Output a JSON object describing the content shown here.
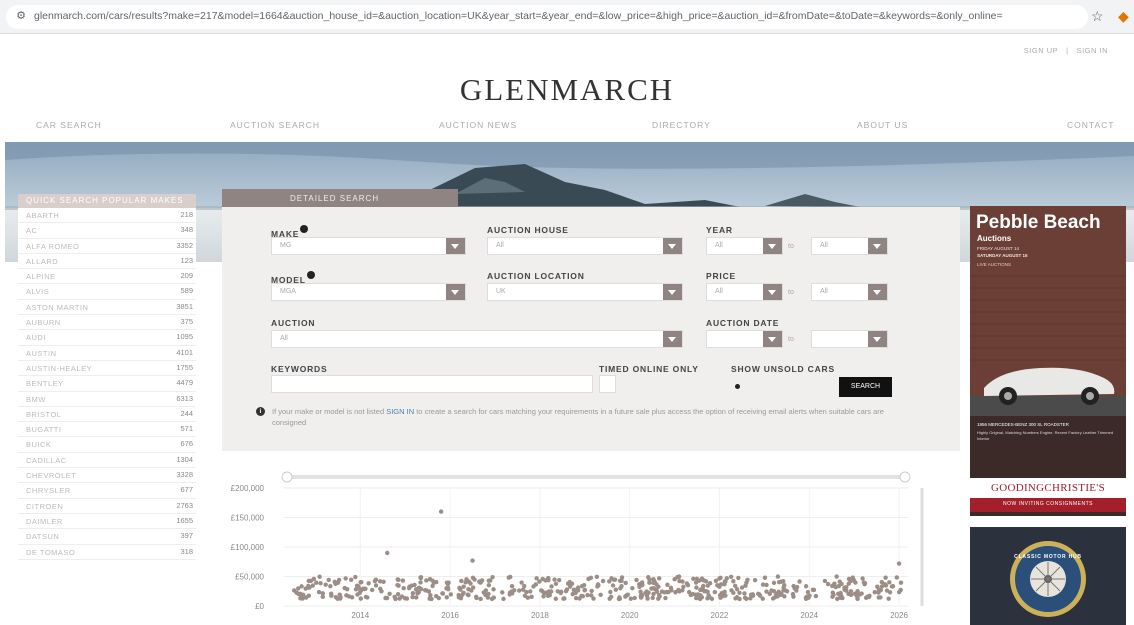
{
  "browser": {
    "url": "glenmarch.com/cars/results?make=217&model=1664&auction_house_id=&auction_location=UK&year_start=&year_end=&low_price=&high_price=&auction_id=&fromDate=&toDate=&keywords=&only_online=",
    "icon": "tune-icon"
  },
  "toplinks": {
    "signup": "SIGN UP",
    "separator": "|",
    "signin": "SIGN IN"
  },
  "logo": "GLENMARCH",
  "nav": {
    "items": [
      "CAR SEARCH",
      "AUCTION SEARCH",
      "AUCTION NEWS",
      "DIRECTORY",
      "ABOUT US",
      "CONTACT"
    ]
  },
  "sidebar": {
    "title": "QUICK SEARCH POPULAR MAKES",
    "makes": [
      {
        "name": "ABARTH",
        "count": "218"
      },
      {
        "name": "AC",
        "count": "348"
      },
      {
        "name": "ALFA ROMEO",
        "count": "3352"
      },
      {
        "name": "ALLARD",
        "count": "123"
      },
      {
        "name": "ALPINE",
        "count": "209"
      },
      {
        "name": "ALVIS",
        "count": "589"
      },
      {
        "name": "ASTON MARTIN",
        "count": "3851"
      },
      {
        "name": "AUBURN",
        "count": "375"
      },
      {
        "name": "AUDI",
        "count": "1095"
      },
      {
        "name": "AUSTIN",
        "count": "4101"
      },
      {
        "name": "AUSTIN-HEALEY",
        "count": "1755"
      },
      {
        "name": "BENTLEY",
        "count": "4479"
      },
      {
        "name": "BMW",
        "count": "6313"
      },
      {
        "name": "BRISTOL",
        "count": "244"
      },
      {
        "name": "BUGATTI",
        "count": "571"
      },
      {
        "name": "BUICK",
        "count": "676"
      },
      {
        "name": "CADILLAC",
        "count": "1304"
      },
      {
        "name": "CHEVROLET",
        "count": "3328"
      },
      {
        "name": "CHRYSLER",
        "count": "677"
      },
      {
        "name": "CITROEN",
        "count": "2763"
      },
      {
        "name": "DAIMLER",
        "count": "1655"
      },
      {
        "name": "DATSUN",
        "count": "397"
      },
      {
        "name": "DE TOMASO",
        "count": "318"
      }
    ]
  },
  "search": {
    "tab_label": "DETAILED SEARCH",
    "make_label": "MAKE",
    "make_value": "MG",
    "model_label": "MODEL",
    "model_value": "MGA",
    "auction_house_label": "AUCTION HOUSE",
    "auction_house_value": "All",
    "auction_location_label": "AUCTION LOCATION",
    "auction_location_value": "UK",
    "auction_label": "AUCTION",
    "auction_value": "All",
    "year_label": "YEAR",
    "year_from": "All",
    "year_to": "All",
    "to_word": "to",
    "price_label": "PRICE",
    "price_from": "All",
    "price_to": "All",
    "auction_date_label": "AUCTION DATE",
    "keywords_label": "KEYWORDS",
    "timed_online_label": "TIMED ONLINE ONLY",
    "show_unsold_label": "SHOW UNSOLD CARS",
    "search_button": "SEARCH",
    "info_pre": "If your make or model is not listed ",
    "info_link": "SIGN IN",
    "info_post": " to create a search for cars matching your requirements in a future sale plus access the option of receiving email alerts when suitable cars are consigned"
  },
  "chart_data": {
    "type": "scatter",
    "ylim": [
      0,
      200000
    ],
    "xlim": [
      2012.3,
      2026.2
    ],
    "y_ticks": [
      {
        "v": 0,
        "label": "£0"
      },
      {
        "v": 50000,
        "label": "£50,000"
      },
      {
        "v": 100000,
        "label": "£100,000"
      },
      {
        "v": 150000,
        "label": "£150,000"
      },
      {
        "v": 200000,
        "label": "£200,000"
      }
    ],
    "x_ticks": [
      {
        "v": 2014,
        "label": "2014"
      },
      {
        "v": 2016,
        "label": "2016"
      },
      {
        "v": 2018,
        "label": "2018"
      },
      {
        "v": 2020,
        "label": "2020"
      },
      {
        "v": 2022,
        "label": "2022"
      },
      {
        "v": 2024,
        "label": "2024"
      },
      {
        "v": 2026,
        "label": "2026"
      }
    ],
    "point_color": "#9c8d86",
    "outliers": [
      [
        2015.8,
        160000
      ],
      [
        2014.6,
        90000
      ],
      [
        2016.5,
        77000
      ],
      [
        2026.0,
        72000
      ]
    ],
    "cluster_range_years": [
      2012.5,
      2026.1
    ],
    "cluster_price_range": [
      12000,
      50000
    ]
  },
  "ads": {
    "pebble_title": "Pebble Beach",
    "pebble_sub": "Auctions",
    "pebble_line1": "FRIDAY AUGUST 14",
    "pebble_line2": "SATURDAY AUGUST 15",
    "pebble_line3": "LIVE AUCTIONS",
    "pebble_caption": "1956 MERCEDES-BENZ 300 SL ROADSTER",
    "pebble_detail": "Highly Original, Matching Numbers Engine, Recent Factory Leather Trimmed Interior",
    "brand": "GOODINGCHRISTIE'S",
    "brand_tag": "NOW INVITING CONSIGNMENTS",
    "badge_text": "CLASSIC MOTOR HUB"
  }
}
